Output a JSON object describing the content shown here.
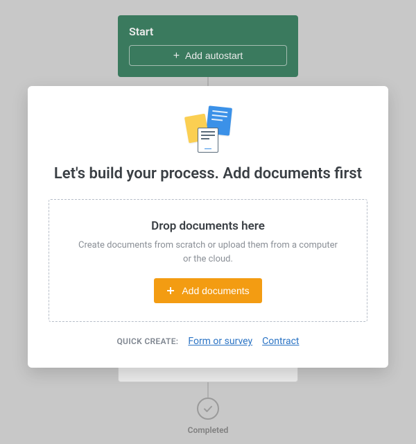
{
  "flow": {
    "start_label": "Start",
    "autostart_label": "Add autostart",
    "completed_label": "Completed"
  },
  "modal": {
    "title": "Let's build your process. Add documents first",
    "dropzone": {
      "title": "Drop documents here",
      "subtitle": "Create documents from scratch or upload them from a computer or the cloud.",
      "button_label": "Add documents"
    },
    "quick_create": {
      "label": "QUICK CREATE:",
      "links": [
        {
          "label": "Form or survey"
        },
        {
          "label": "Contract"
        }
      ]
    }
  },
  "icons": {
    "plus": "plus-icon",
    "check": "check-icon",
    "documents": "documents-illustration"
  },
  "colors": {
    "accent_orange": "#f39c12",
    "start_green": "#3f8566",
    "link_blue": "#2a73c4"
  }
}
